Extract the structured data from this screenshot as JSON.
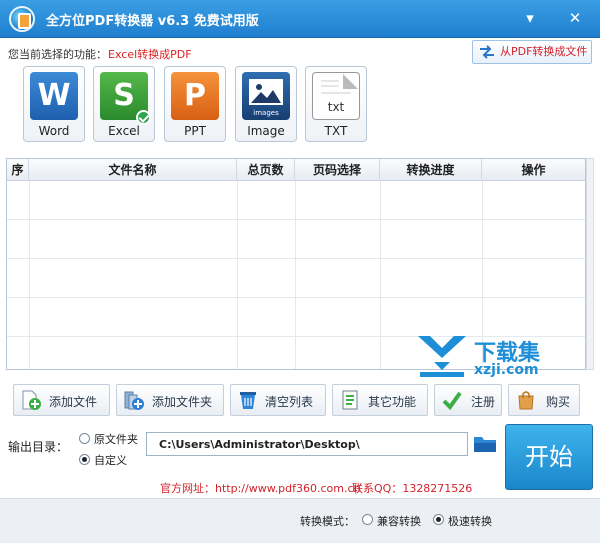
{
  "window": {
    "title": "全方位PDF转换器 v6.3 免费试用版",
    "controls": [
      "dropdown-icon",
      "close-icon"
    ]
  },
  "function_row": {
    "label": "您当前选择的功能：",
    "value": "Excel转换成PDF",
    "from_pdf_button": "从PDF转换成文件"
  },
  "formats": [
    {
      "label": "Word",
      "glyph": "W"
    },
    {
      "label": "Excel",
      "glyph": "S"
    },
    {
      "label": "PPT",
      "glyph": "P"
    },
    {
      "label": "Image",
      "glyph": "images"
    },
    {
      "label": "TXT",
      "glyph": "txt"
    }
  ],
  "table": {
    "columns": [
      "序",
      "文件名称",
      "总页数",
      "页码选择",
      "转换进度",
      "操作"
    ],
    "rows": []
  },
  "toolbar": {
    "add_file": "添加文件",
    "add_folder": "添加文件夹",
    "clear_list": "清空列表",
    "other": "其它功能",
    "register": "注册",
    "buy": "购买"
  },
  "output": {
    "label": "输出目录：",
    "opt_source": "原文件夹",
    "opt_custom": "自定义",
    "path": "C:\\Users\\Administrator\\Desktop\\",
    "start": "开始"
  },
  "contact": {
    "website": "官方网址：http://www.pdf360.com.cn",
    "qq": "联系QQ：1328271526"
  },
  "mode": {
    "label": "转换模式：",
    "compatible": "兼容转换",
    "fast": "极速转换"
  },
  "watermark": {
    "text": "下载集",
    "url": "xzji.com"
  },
  "colors": {
    "title_bar": "#1f7fcf",
    "accent_red": "#d2232a",
    "start_button": "#1a87cc"
  }
}
